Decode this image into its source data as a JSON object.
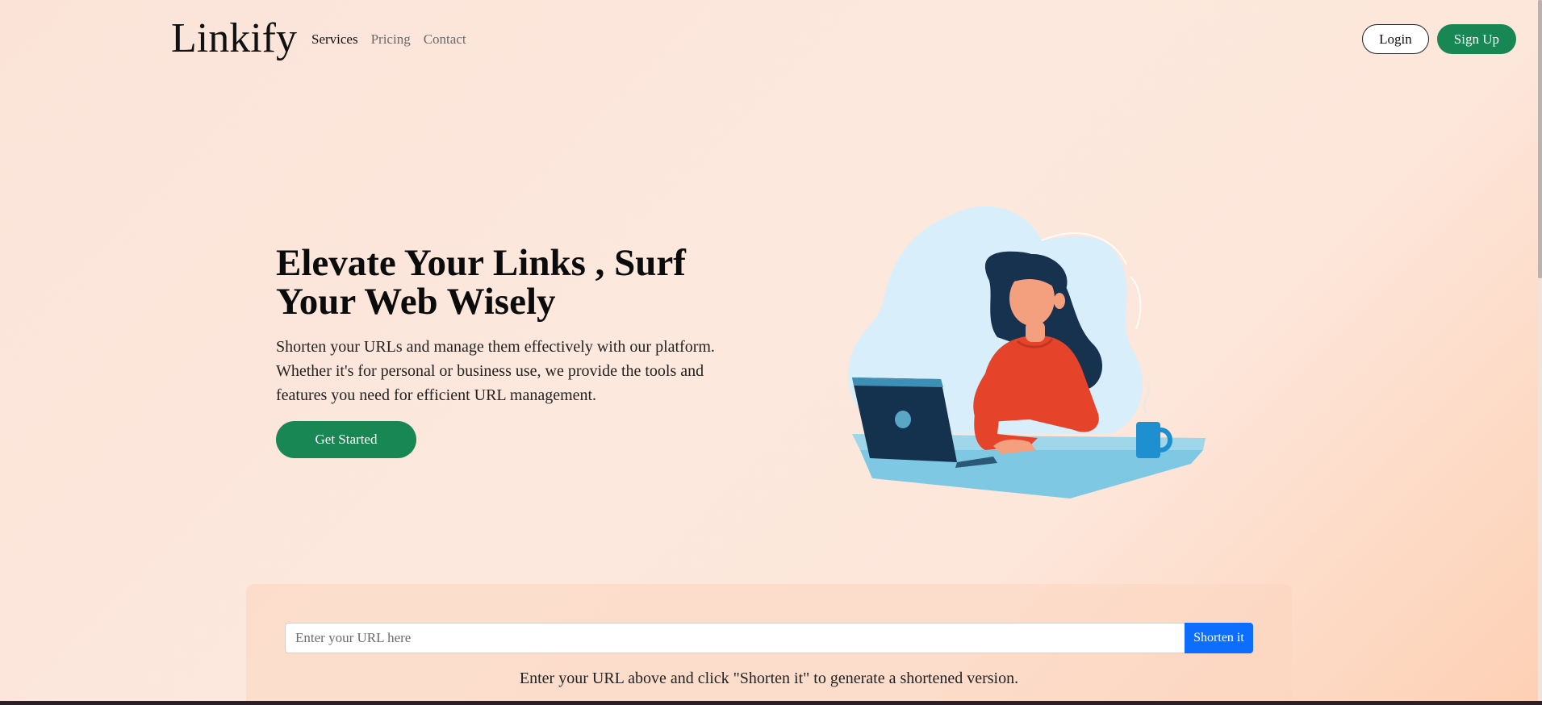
{
  "navbar": {
    "brand": "Linkify",
    "links": [
      {
        "label": "Services",
        "active": true
      },
      {
        "label": "Pricing",
        "active": false
      },
      {
        "label": "Contact",
        "active": false
      }
    ],
    "login_label": "Login",
    "signup_label": "Sign Up"
  },
  "hero": {
    "title": "Elevate Your Links , Surf Your Web Wisely",
    "subtitle": "Shorten your URLs and manage them effectively with our platform. Whether it's for personal or business use, we provide the tools and features you need for efficient URL management.",
    "cta_label": "Get Started",
    "illustration_icon": "woman-at-laptop-illustration"
  },
  "shortener": {
    "placeholder": "Enter your URL here",
    "value": "",
    "button_label": "Shorten it",
    "helper_text": "Enter your URL above and click \"Shorten it\" to generate a shortened version."
  },
  "colors": {
    "primary_green": "#198754",
    "button_blue": "#0d6efd",
    "background_peach": "#fbe3d8"
  }
}
